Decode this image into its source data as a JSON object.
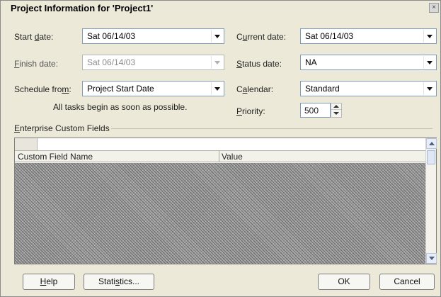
{
  "window": {
    "title": "Project Information for 'Project1'",
    "close_glyph": "×"
  },
  "left": {
    "start_date": {
      "label_pre": "Start ",
      "label_key": "d",
      "label_post": "ate:",
      "value": "Sat 06/14/03"
    },
    "finish_date": {
      "label_pre": "",
      "label_key": "F",
      "label_post": "inish date:",
      "value": "Sat 06/14/03"
    },
    "schedule_from": {
      "label_pre": "Schedule fro",
      "label_key": "m",
      "label_post": ":",
      "value": "Project Start Date"
    },
    "info_text": "All tasks begin as soon as possible."
  },
  "right": {
    "current_date": {
      "label_pre": "C",
      "label_key": "u",
      "label_post": "rrent date:",
      "value": "Sat 06/14/03"
    },
    "status_date": {
      "label_pre": "",
      "label_key": "S",
      "label_post": "tatus date:",
      "value": "NA"
    },
    "calendar": {
      "label_pre": "C",
      "label_key": "a",
      "label_post": "lendar:",
      "value": "Standard"
    },
    "priority": {
      "label_pre": "",
      "label_key": "P",
      "label_post": "riority:",
      "value": "500"
    }
  },
  "enterprise": {
    "heading_pre": "",
    "heading_key": "E",
    "heading_post": "nterprise Custom Fields",
    "columns": [
      "Custom Field Name",
      "Value"
    ]
  },
  "buttons": {
    "help": {
      "pre": "",
      "key": "H",
      "post": "elp"
    },
    "statistics": {
      "pre": "Stati",
      "key": "s",
      "post": "tics..."
    },
    "ok": "OK",
    "cancel": "Cancel"
  },
  "icons": {
    "dropdown": "chevron-down-icon",
    "spin_up": "spin-up-icon",
    "spin_down": "spin-down-icon",
    "scroll_up": "scroll-up-icon",
    "scroll_down": "scroll-down-icon"
  }
}
